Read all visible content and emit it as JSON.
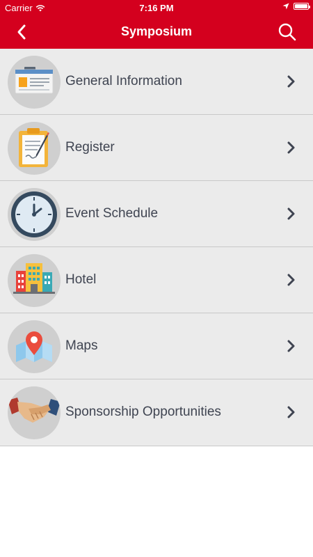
{
  "status_bar": {
    "carrier": "Carrier",
    "time": "7:16 PM"
  },
  "nav": {
    "title": "Symposium",
    "back_icon": "chevron-left-icon",
    "search_icon": "search-icon"
  },
  "colors": {
    "accent": "#d4001e",
    "row_background": "#ebebeb",
    "label_text": "#3f4451"
  },
  "menu": {
    "items": [
      {
        "label": "General Information",
        "icon": "id-card-icon"
      },
      {
        "label": "Register",
        "icon": "clipboard-icon"
      },
      {
        "label": "Event Schedule",
        "icon": "clock-icon"
      },
      {
        "label": "Hotel",
        "icon": "hotel-icon"
      },
      {
        "label": "Maps",
        "icon": "map-pin-icon"
      },
      {
        "label": "Sponsorship Opportunities",
        "icon": "handshake-icon"
      }
    ]
  }
}
